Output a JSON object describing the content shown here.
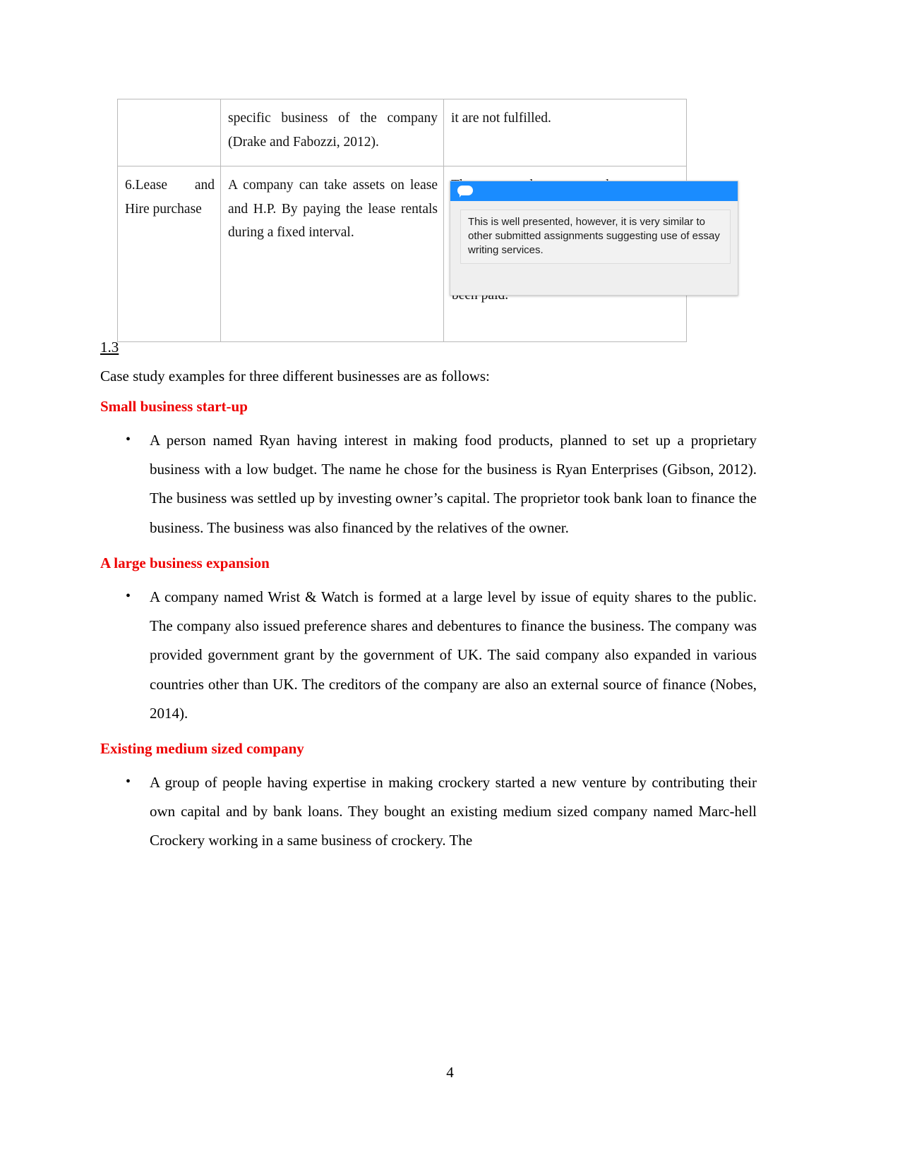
{
  "document": {
    "page_number": "4"
  },
  "table": {
    "rows": [
      {
        "col1": "",
        "col2": "specific business of the company (Drake and Fabozzi, 2012).",
        "col3": "it are not fulfilled."
      },
      {
        "col1": "6.Lease and Hire purchase",
        "col2": "A company can take assets on lease and H.P. By paying the lease rentals during a fixed interval.",
        "col3": "The company has to return the asset"
      }
    ],
    "obscured_partial_text": "been paid."
  },
  "comment": {
    "icon": "speech-bubble-icon",
    "header_color": "#1a8cff",
    "text": "This is well presented, however, it is very similar to other submitted assignments suggesting use of essay writing services."
  },
  "section": {
    "number": "1.3",
    "intro": "Case study examples for three different businesses are as follows:",
    "heading_color": "#ee0000",
    "groups": [
      {
        "heading": "Small business start-up",
        "bullets": [
          "A person named Ryan having interest in making food products, planned to set up a proprietary business with a low budget. The name he chose for the business is Ryan Enterprises (Gibson, 2012). The business was settled up by investing owner’s capital. The proprietor took bank loan to finance the business. The business was also financed by the relatives of the owner."
        ]
      },
      {
        "heading": "A large business expansion",
        "bullets": [
          "A company named Wrist & Watch is formed at a large level by issue of equity shares to the public. The company also issued preference shares and debentures to finance the business. The company was provided government grant by the government of UK. The said company also expanded in various countries other than UK. The creditors of the company are also an external source of finance (Nobes, 2014)."
        ]
      },
      {
        "heading": "Existing medium sized company",
        "bullets": [
          "A group of people having expertise in making crockery started a new venture by contributing their own capital and by bank loans. They bought an existing medium sized company named Marc-hell Crockery working in a same business of crockery. The"
        ]
      }
    ]
  }
}
